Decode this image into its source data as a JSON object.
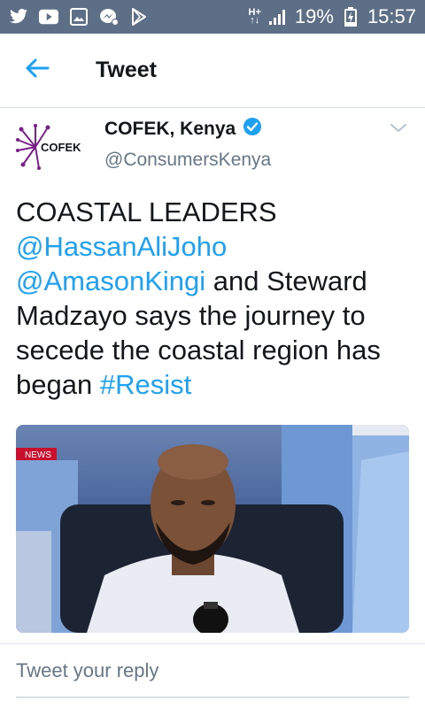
{
  "status_bar": {
    "left_icons": [
      "twitter-icon",
      "youtube-icon",
      "gallery-icon",
      "messenger-icon",
      "playstore-icon"
    ],
    "network": "H+",
    "battery": "19%",
    "time": "15:57"
  },
  "app_bar": {
    "back_icon": "back-arrow-icon",
    "title": "Tweet"
  },
  "tweet": {
    "author": {
      "display_name": "COFEK, Kenya",
      "handle": "@ConsumersKenya",
      "avatar_text": "COFEK",
      "verified": true
    },
    "text": {
      "line1": "COASTAL LEADERS",
      "mention1": "@HassanAliJoho",
      "mention2": "@AmasonKingi",
      "mid": " and Steward Madzayo says the journey to secede the coastal region has began ",
      "hashtag": "#Resist"
    },
    "media": {
      "badge": "NEWS"
    }
  },
  "reply": {
    "placeholder": "Tweet your reply"
  },
  "colors": {
    "status_bar": "#5d6f86",
    "accent": "#1da1f2",
    "text": "#14171a",
    "muted": "#657786"
  }
}
